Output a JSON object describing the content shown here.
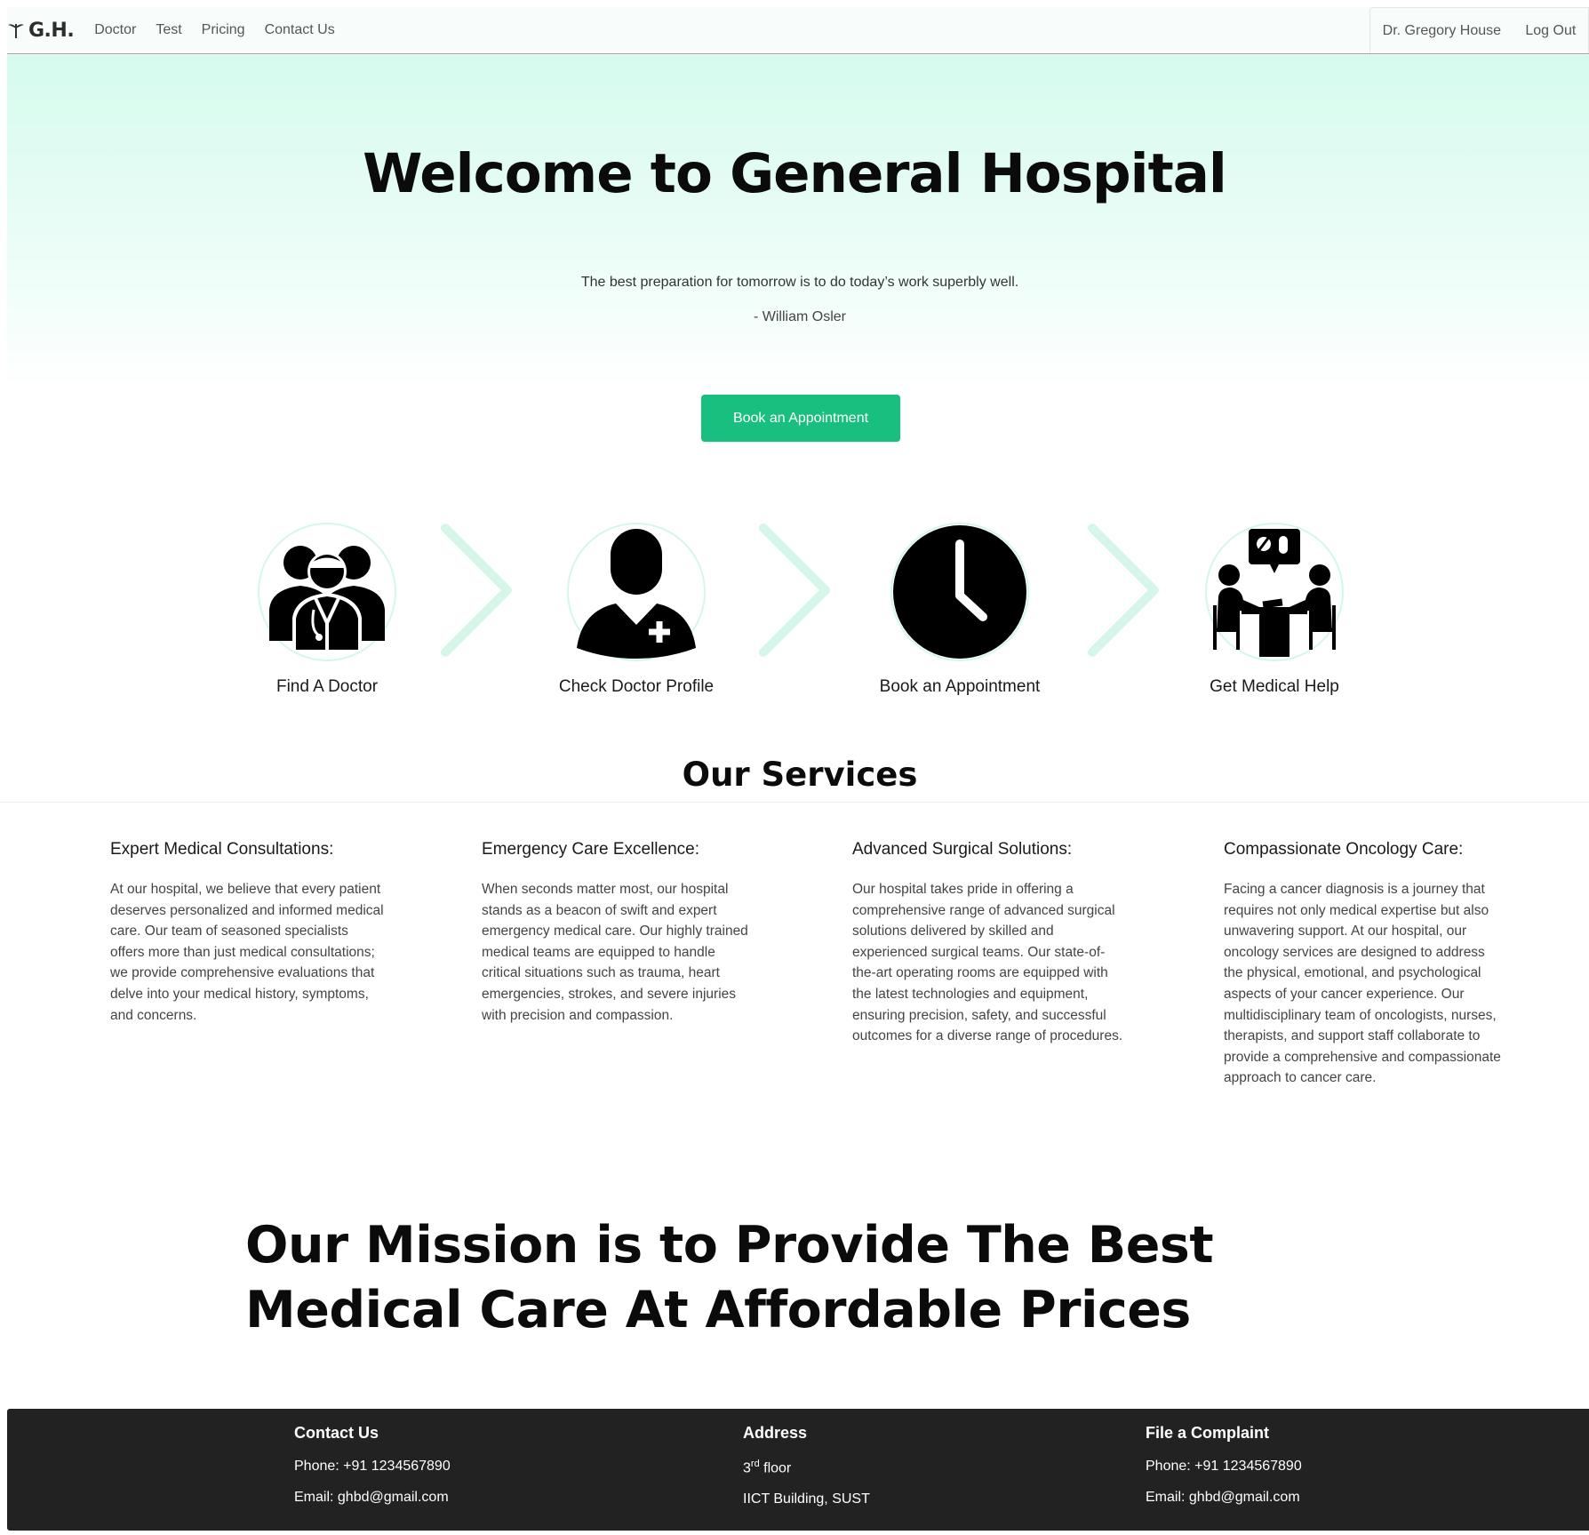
{
  "navbar": {
    "brand": "G.H.",
    "brand_icon": "caduceus-icon",
    "links": [
      "Doctor",
      "Test",
      "Pricing",
      "Contact Us"
    ],
    "user_name": "Dr. Gregory House",
    "logout": "Log Out"
  },
  "hero": {
    "title": "Welcome to General Hospital",
    "quote": "The best preparation for tomorrow is to do today’s work superbly well.",
    "author": "- William Osler",
    "cta": "Book an Appointment"
  },
  "steps": [
    {
      "label": "Find A Doctor",
      "icon": "doctors-group-icon"
    },
    {
      "label": "Check Doctor Profile",
      "icon": "doctor-profile-icon"
    },
    {
      "label": "Book an Appointment",
      "icon": "clock-icon"
    },
    {
      "label": "Get Medical Help",
      "icon": "consultation-icon"
    }
  ],
  "services": {
    "title": "Our Services",
    "items": [
      {
        "title": "Expert Medical Consultations:",
        "text": "At our hospital, we believe that every patient deserves personalized and informed medical care. Our team of seasoned specialists offers more than just medical consultations; we provide comprehensive evaluations that delve into your medical history, symptoms, and concerns."
      },
      {
        "title": "Emergency Care Excellence:",
        "text": "When seconds matter most, our hospital stands as a beacon of swift and expert emergency medical care. Our highly trained medical teams are equipped to handle critical situations such as trauma, heart emergencies, strokes, and severe injuries with precision and compassion."
      },
      {
        "title": "Advanced Surgical Solutions:",
        "text": "Our hospital takes pride in offering a comprehensive range of advanced surgical solutions delivered by skilled and experienced surgical teams. Our state-of-the-art operating rooms are equipped with the latest technologies and equipment, ensuring precision, safety, and successful outcomes for a diverse range of procedures."
      },
      {
        "title": "Compassionate Oncology Care:",
        "text": "Facing a cancer diagnosis is a journey that requires not only medical expertise but also unwavering support. At our hospital, our oncology services are designed to address the physical, emotional, and psychological aspects of your cancer experience. Our multidisciplinary team of oncologists, nurses, therapists, and support staff collaborate to provide a comprehensive and compassionate approach to cancer care."
      }
    ]
  },
  "mission": {
    "line1": "Our Mission is to Provide The Best",
    "line2": "Medical Care At Affordable Prices"
  },
  "footer": {
    "contact": {
      "title": "Contact Us",
      "phone": "Phone: +91 1234567890",
      "email": "Email: ghbd@gmail.com"
    },
    "address": {
      "title": "Address",
      "floor_num": "3",
      "floor_sup": "rd",
      "floor_word": " floor",
      "building": "IICT Building, SUST"
    },
    "complaint": {
      "title": "File a Complaint",
      "phone": "Phone: +91 1234567890",
      "email": "Email: ghbd@gmail.com"
    }
  },
  "colors": {
    "accent": "#18bf7e",
    "hero_tint": "#d6fbee",
    "chevron": "#d4f7ea",
    "footer_bg": "#222222"
  }
}
